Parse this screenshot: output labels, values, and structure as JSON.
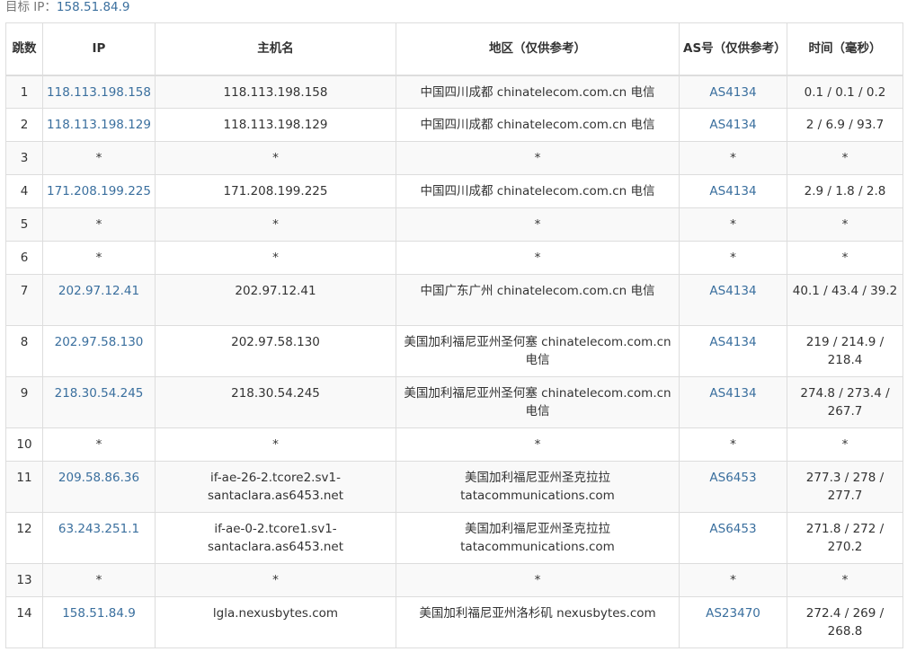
{
  "target": {
    "label": "目标 IP：",
    "ip": "158.51.84.9"
  },
  "columns": {
    "hop": "跳数",
    "ip": "IP",
    "host": "主机名",
    "location": "地区（仅供参考）",
    "as": "AS号（仅供参考）",
    "time": "时间（毫秒）"
  },
  "rows": [
    {
      "hop": "1",
      "ip": "118.113.198.158",
      "host": "118.113.198.158",
      "location": "中国四川成都 chinatelecom.com.cn 电信",
      "as": "AS4134",
      "time": "0.1 / 0.1 / 0.2"
    },
    {
      "hop": "2",
      "ip": "118.113.198.129",
      "host": "118.113.198.129",
      "location": "中国四川成都 chinatelecom.com.cn 电信",
      "as": "AS4134",
      "time": "2 / 6.9 / 93.7"
    },
    {
      "hop": "3",
      "ip": "*",
      "host": "*",
      "location": "*",
      "as": "*",
      "time": "*"
    },
    {
      "hop": "4",
      "ip": "171.208.199.225",
      "host": "171.208.199.225",
      "location": "中国四川成都 chinatelecom.com.cn 电信",
      "as": "AS4134",
      "time": "2.9 / 1.8 / 2.8"
    },
    {
      "hop": "5",
      "ip": "*",
      "host": "*",
      "location": "*",
      "as": "*",
      "time": "*"
    },
    {
      "hop": "6",
      "ip": "*",
      "host": "*",
      "location": "*",
      "as": "*",
      "time": "*"
    },
    {
      "hop": "7",
      "ip": "202.97.12.41",
      "host": "202.97.12.41",
      "location": "中国广东广州 chinatelecom.com.cn 电信",
      "as": "AS4134",
      "time": "40.1 / 43.4 / 39.2"
    },
    {
      "hop": "8",
      "ip": "202.97.58.130",
      "host": "202.97.58.130",
      "location": "美国加利福尼亚州圣何塞 chinatelecom.com.cn 电信",
      "as": "AS4134",
      "time": "219 / 214.9 / 218.4"
    },
    {
      "hop": "9",
      "ip": "218.30.54.245",
      "host": "218.30.54.245",
      "location": "美国加利福尼亚州圣何塞 chinatelecom.com.cn 电信",
      "as": "AS4134",
      "time": "274.8 / 273.4 / 267.7"
    },
    {
      "hop": "10",
      "ip": "*",
      "host": "*",
      "location": "*",
      "as": "*",
      "time": "*"
    },
    {
      "hop": "11",
      "ip": "209.58.86.36",
      "host": "if-ae-26-2.tcore2.sv1-santaclara.as6453.net",
      "location": "美国加利福尼亚州圣克拉拉 tatacommunications.com",
      "as": "AS6453",
      "time": "277.3 / 278 / 277.7"
    },
    {
      "hop": "12",
      "ip": "63.243.251.1",
      "host": "if-ae-0-2.tcore1.sv1-santaclara.as6453.net",
      "location": "美国加利福尼亚州圣克拉拉 tatacommunications.com",
      "as": "AS6453",
      "time": "271.8 / 272 / 270.2"
    },
    {
      "hop": "13",
      "ip": "*",
      "host": "*",
      "location": "*",
      "as": "*",
      "time": "*"
    },
    {
      "hop": "14",
      "ip": "158.51.84.9",
      "host": "lgla.nexusbytes.com",
      "location": "美国加利福尼亚州洛杉矶 nexusbytes.com",
      "as": "AS23470",
      "time": "272.4 / 269 / 268.8"
    }
  ]
}
